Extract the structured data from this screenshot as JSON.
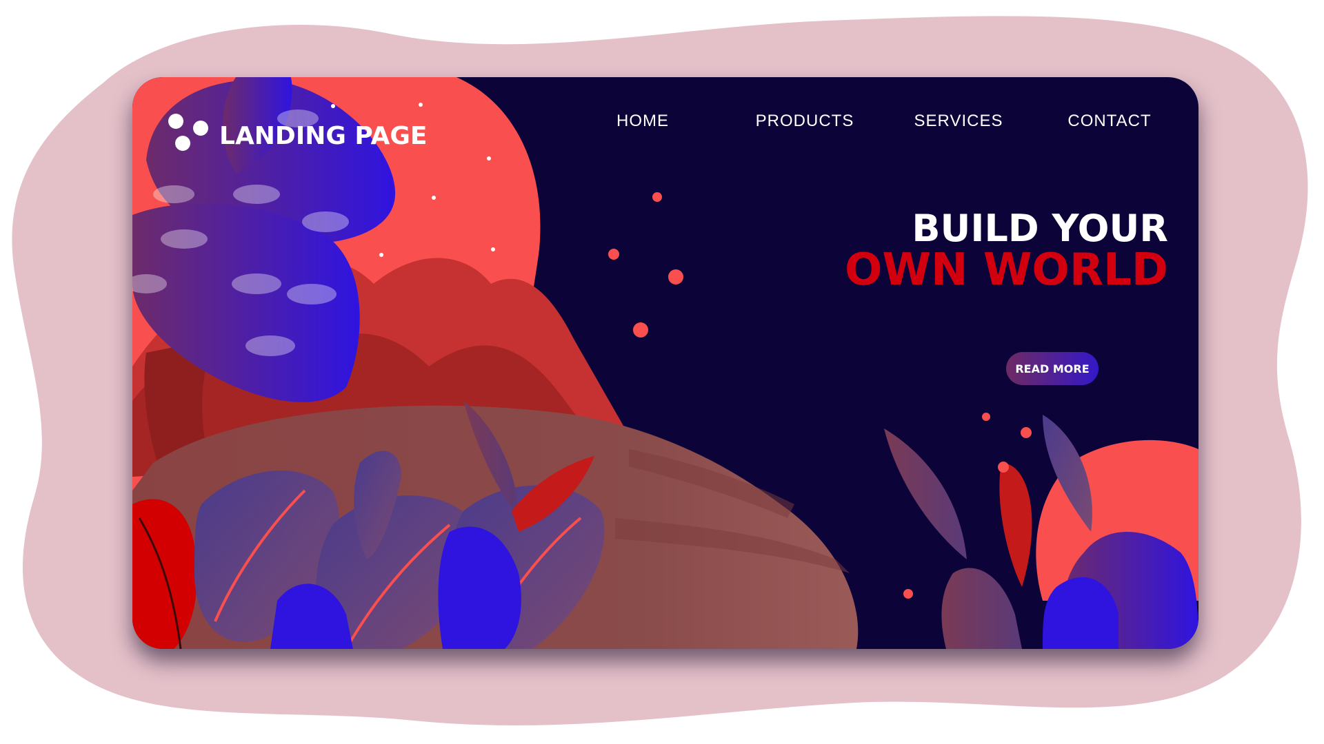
{
  "brand": {
    "name": "LANDING PAGE",
    "logo_icon": "three-dots-logo-icon"
  },
  "nav": {
    "items": [
      {
        "label": "HOME"
      },
      {
        "label": "PRODUCTS"
      },
      {
        "label": "SERVICES"
      },
      {
        "label": "CONTACT"
      }
    ]
  },
  "hero": {
    "title_line1": "BUILD YOUR",
    "title_line2": "OWN WORLD",
    "cta_label": "READ MORE"
  },
  "colors": {
    "backdrop_blob": "#e4c0c9",
    "card_background": "#0c0438",
    "coral": "#f94f4f",
    "accent_red": "#d2000e",
    "leaf_blue": "#2f14e0",
    "hill_brown": "#8a4a4a",
    "button_gradient_start": "#6e2a63",
    "button_gradient_end": "#3418c8"
  }
}
